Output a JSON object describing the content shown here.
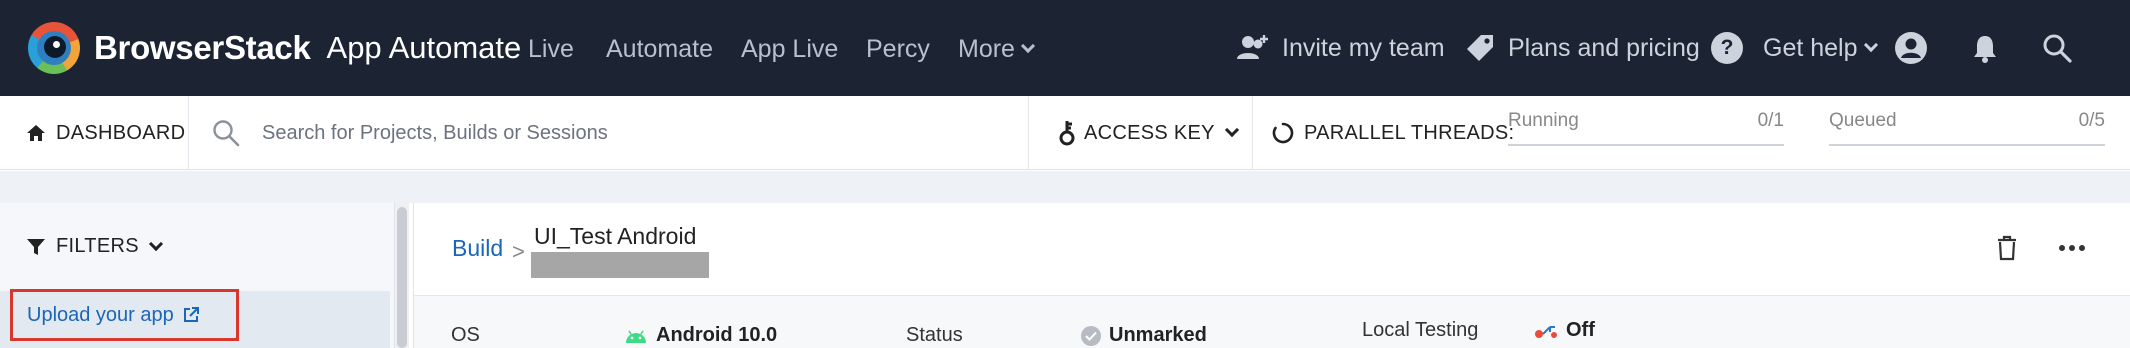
{
  "brand": {
    "name": "BrowserStack",
    "product": "App Automate"
  },
  "nav": {
    "live": "Live",
    "automate": "Automate",
    "app_live": "App Live",
    "percy": "Percy",
    "more": "More"
  },
  "top_right": {
    "invite": "Invite my team",
    "plans": "Plans and pricing",
    "help": "Get help",
    "help_glyph": "?"
  },
  "toolbar": {
    "dashboard": "DASHBOARD",
    "search_placeholder": "Search for Projects, Builds or Sessions",
    "access_key": "ACCESS KEY",
    "parallel_threads": "PARALLEL THREADS:",
    "running_label": "Running",
    "running_value": "0/1",
    "queued_label": "Queued",
    "queued_value": "0/5"
  },
  "filters": {
    "title": "FILTERS",
    "upload": "Upload your app"
  },
  "build": {
    "crumb": "Build",
    "separator": ">",
    "name": "UI_Test Android"
  },
  "details": {
    "os_label": "OS",
    "os_value": "Android 10.0",
    "status_label": "Status",
    "status_value": "Unmarked",
    "local_label": "Local Testing",
    "local_value": "Off"
  },
  "colors": {
    "topbar": "#1c2434",
    "link": "#1a66b8",
    "highlight_border": "#d9372e",
    "android_green": "#3ddc84"
  },
  "icons": [
    "brand-logo-icon",
    "invite-team-icon",
    "tag-icon",
    "help-icon",
    "account-icon",
    "bell-icon",
    "search-icon",
    "home-icon",
    "key-icon",
    "threads-icon",
    "filter-icon",
    "external-link-icon",
    "trash-icon",
    "more-icon",
    "android-icon",
    "local-testing-icon"
  ]
}
